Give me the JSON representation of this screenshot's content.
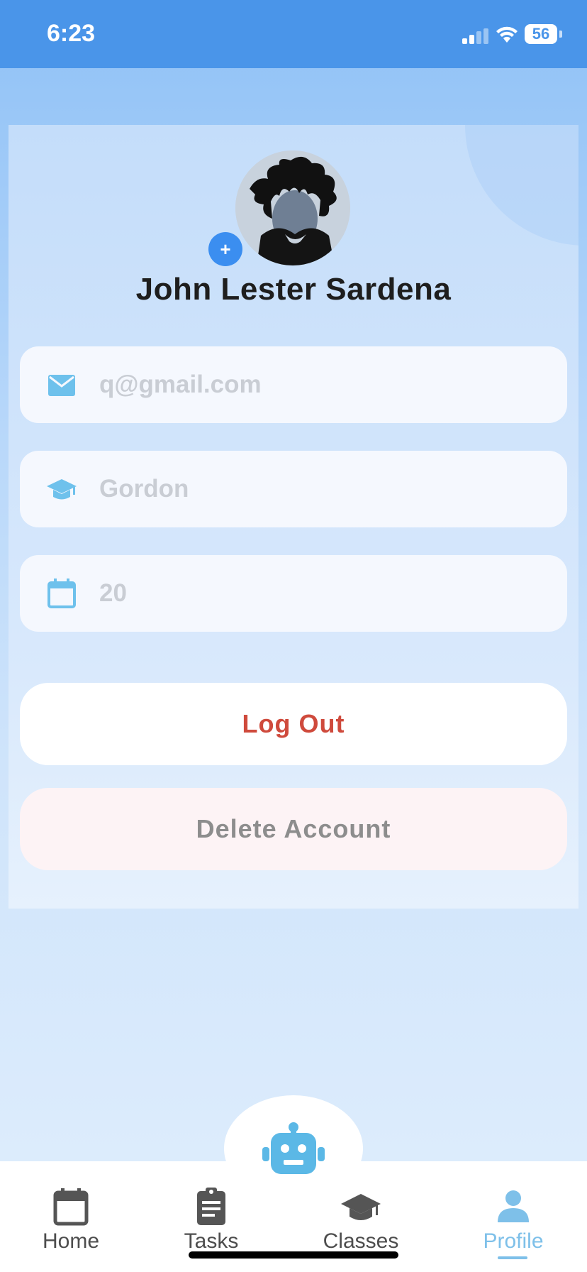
{
  "status_bar": {
    "time": "6:23",
    "battery": "56"
  },
  "profile": {
    "name": "John Lester Sardena",
    "avatar_add_symbol": "+"
  },
  "fields": {
    "email": {
      "placeholder": "q@gmail.com",
      "icon": "mail-icon"
    },
    "school": {
      "placeholder": "Gordon",
      "icon": "graduation-cap-icon"
    },
    "age": {
      "placeholder": "20",
      "icon": "calendar-icon"
    }
  },
  "buttons": {
    "logout": "Log Out",
    "delete_account": "Delete Account"
  },
  "nav": {
    "items": [
      {
        "label": "Home",
        "icon": "calendar-icon"
      },
      {
        "label": "Tasks",
        "icon": "clipboard-icon"
      },
      {
        "label": "Classes",
        "icon": "graduation-cap-icon"
      },
      {
        "label": "Profile",
        "icon": "person-icon"
      }
    ],
    "active": "Profile"
  },
  "colors": {
    "status_bar": "#4a95e9",
    "accent": "#7ec0e9",
    "logout_text": "#cf4a3c",
    "add_button": "#3b8ef0"
  }
}
